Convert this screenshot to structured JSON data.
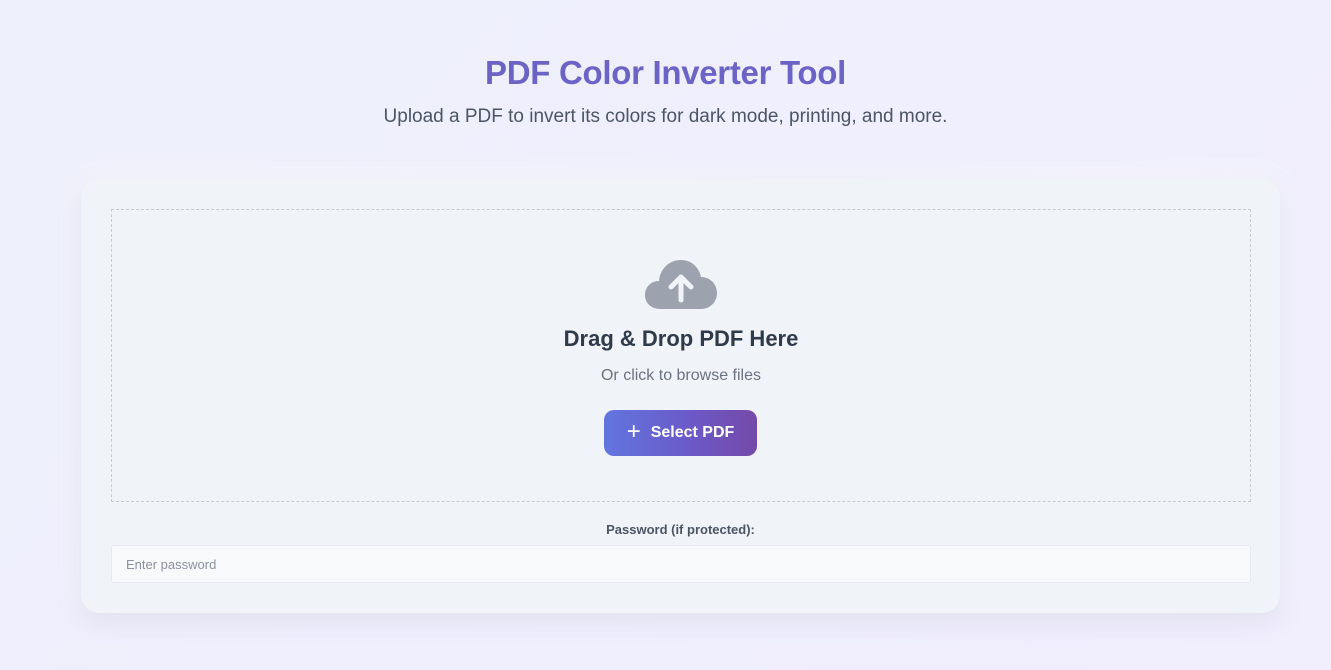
{
  "header": {
    "title": "PDF Color Inverter Tool",
    "subtitle": "Upload a PDF to invert its colors for dark mode, printing, and more."
  },
  "dropzone": {
    "icon": "cloud-upload-icon",
    "title": "Drag & Drop PDF Here",
    "subtitle": "Or click to browse files",
    "button_icon": "plus-icon",
    "button_label": "Select PDF"
  },
  "password": {
    "label": "Password (if protected):",
    "value": "",
    "placeholder": "Enter password"
  },
  "colors": {
    "accent": "#6b63c6",
    "button_start": "#6275df",
    "button_end": "#7549a8",
    "icon": "#9ca3af"
  }
}
